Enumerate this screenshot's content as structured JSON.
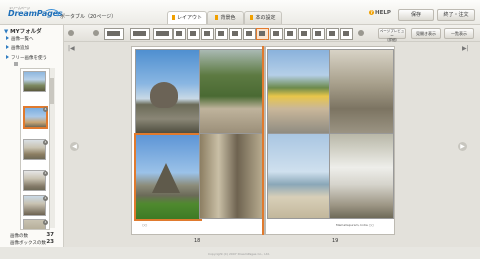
{
  "app": {
    "logo_small": "ドリームページ",
    "logo_text": "DreamPages",
    "project_title": "ポータブル（20ページ）"
  },
  "tabs": [
    {
      "label": "レイアウト",
      "active": true
    },
    {
      "label": "背景色",
      "active": false
    },
    {
      "label": "本の設定",
      "active": false
    }
  ],
  "header": {
    "help_label": "HELP",
    "save_label": "保存",
    "finish_label": "終了・注文"
  },
  "toolbar": {
    "page_preview_label": "ページプレビュー",
    "page_preview_hint": "（詳細）",
    "display_pages_label": "見開き表示",
    "list_view_label": "一覧表示"
  },
  "sidebar": {
    "folder_label": "MYフォルダ",
    "items": [
      {
        "label": "画像一覧へ"
      },
      {
        "label": "画像追加"
      },
      {
        "label": "フリー画像を使う"
      }
    ],
    "thumb_badges": [
      "4",
      "4",
      "4",
      "4",
      "4"
    ],
    "stats": [
      {
        "label": "画像の数",
        "value": "37"
      },
      {
        "label": "画像ボックスの数",
        "value": "23"
      }
    ]
  },
  "spread": {
    "left_page_number": "18",
    "right_page_number": "19",
    "left_caption": "○○",
    "right_caption": "Mamallapuram, India ○○"
  },
  "footer": {
    "copyright": "Copyright (C) 2007 DreamPages Co., Ltd."
  },
  "colors": {
    "accent": "#e07a2e",
    "brand": "#1f6fb8",
    "tab_marker": "#f0a000"
  }
}
